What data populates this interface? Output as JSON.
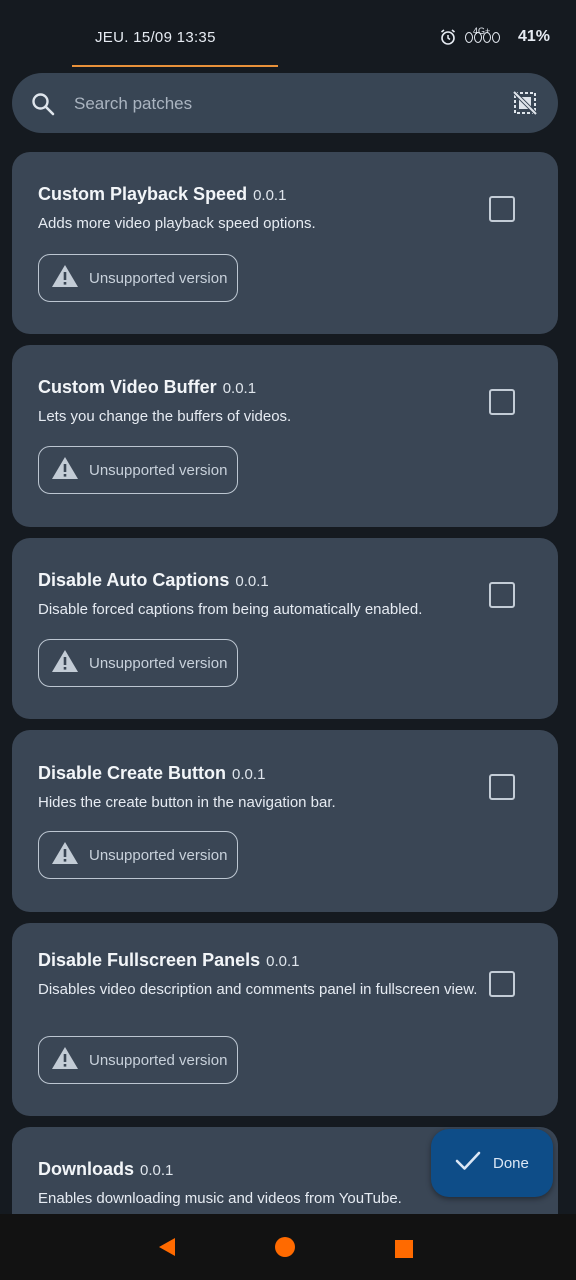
{
  "status_bar": {
    "datetime": "JEU. 15/09 13:35",
    "network": "4G+",
    "battery": "41%",
    "accent_color": "#e8913a"
  },
  "search": {
    "placeholder": "Search patches",
    "icon": "search-icon",
    "filter_icon": "filter-icon"
  },
  "patches": [
    {
      "name": "Custom Playback Speed",
      "version": "0.0.1",
      "description": "Adds more video playback speed options.",
      "badge": "Unsupported version",
      "checked": false
    },
    {
      "name": "Custom Video Buffer",
      "version": "0.0.1",
      "description": "Lets you change the buffers of videos.",
      "badge": "Unsupported version",
      "checked": false
    },
    {
      "name": "Disable Auto Captions",
      "version": "0.0.1",
      "description": "Disable forced captions from being automatically enabled.",
      "badge": "Unsupported version",
      "checked": false
    },
    {
      "name": "Disable Create Button",
      "version": "0.0.1",
      "description": "Hides the create button in the navigation bar.",
      "badge": "Unsupported version",
      "checked": false
    },
    {
      "name": "Disable Fullscreen Panels",
      "version": "0.0.1",
      "description": "Disables video description and comments panel in fullscreen view.",
      "badge": "Unsupported version",
      "checked": false
    },
    {
      "name": "Downloads",
      "version": "0.0.1",
      "description": "Enables downloading music and videos from YouTube.",
      "checked": false
    }
  ],
  "fab": {
    "label": "Done",
    "icon": "check-icon",
    "color": "#0e4d88"
  },
  "nav": {
    "back_color": "#ff6a00",
    "home_color": "#ff6a00",
    "recents_color": "#ff6a00"
  }
}
